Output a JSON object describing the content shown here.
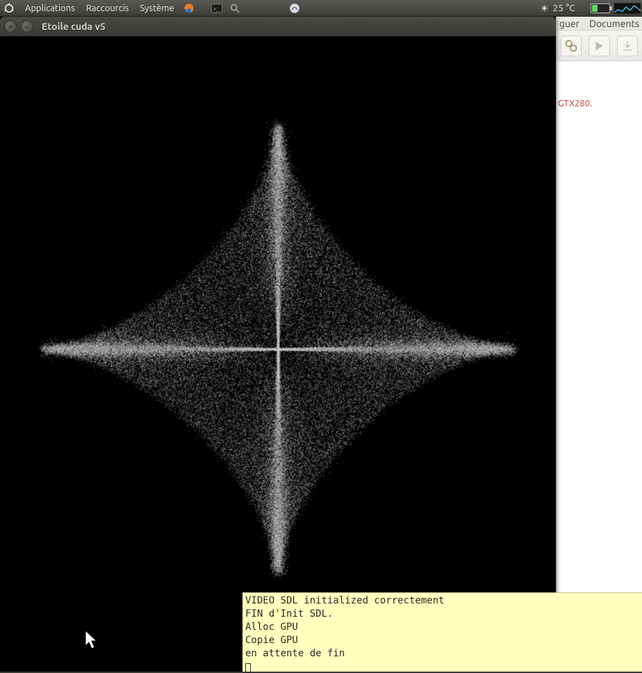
{
  "panel": {
    "menus": [
      "Applications",
      "Raccourcis",
      "Système"
    ],
    "temperature": "25 °C"
  },
  "window": {
    "title": "Etoile cuda v5"
  },
  "ide": {
    "menus": [
      "guer",
      "Documents"
    ],
    "snippet": "GTX280."
  },
  "terminal": {
    "lines": [
      "VIDEO SDL initialized correctement",
      "FIN d'Init SDL.",
      "Alloc GPU",
      "Copie GPU",
      "en attente de fin"
    ]
  }
}
